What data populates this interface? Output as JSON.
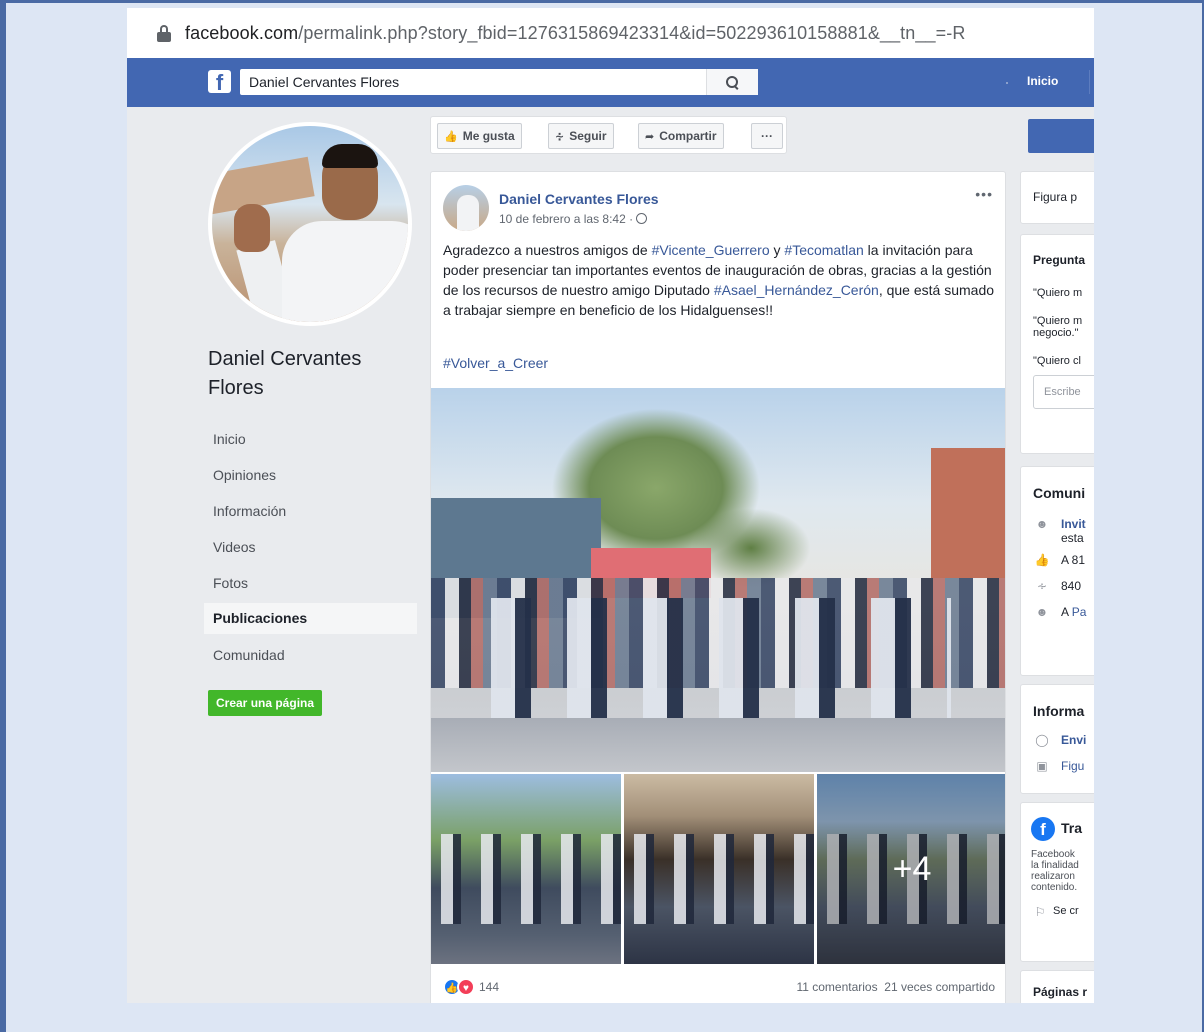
{
  "browser": {
    "url_host": "facebook.com",
    "url_rest": "/permalink.php?story_fbid=1276315869423314&id=502293610158881&__tn__=-R"
  },
  "topbar": {
    "logo": "f",
    "search_value": "Daniel Cervantes Flores",
    "home_label": "Inicio"
  },
  "page": {
    "name": "Daniel Cervantes Flores",
    "nav": [
      {
        "label": "Inicio"
      },
      {
        "label": "Opiniones"
      },
      {
        "label": "Información"
      },
      {
        "label": "Videos"
      },
      {
        "label": "Fotos"
      },
      {
        "label": "Publicaciones",
        "active": true
      },
      {
        "label": "Comunidad"
      }
    ],
    "create_page_label": "Crear una página"
  },
  "actions": {
    "like_label": "Me gusta",
    "follow_label": "Seguir",
    "share_label": "Compartir",
    "more_label": "···"
  },
  "post": {
    "author": "Daniel Cervantes Flores",
    "date": "10 de febrero a las 8:42 ·",
    "more": "•••",
    "text_1": "Agradezco a nuestros amigos de ",
    "tag_1": "#Vicente_Guerrero",
    "text_2": " y ",
    "tag_2": "#Tecomatlan",
    "text_3": " la invitación para poder presenciar tan importantes eventos de inauguración de obras, gracias a la gestión de los recursos de nuestro amigo Diputado ",
    "tag_3": "#Asael_Hernández_Cerón",
    "text_4": ", que está sumado a trabajar siempre en beneficio de los Hidalguenses!!",
    "hashtag": "#Volver_a_Creer",
    "more_photos": "+4",
    "reactions_count": "144",
    "comments": "11 comentarios",
    "shares": "21 veces compartido"
  },
  "sidebar": {
    "card1_title": "Figura p",
    "card2_title": "Pregunta",
    "q1": "\"Quiero m",
    "q2a": "\"Quiero m",
    "q2b": "negocio.\"",
    "q3": "\"Quiero cl",
    "input_placeholder": "Escribe",
    "card3_title": "Comuni",
    "c1a": "Invit",
    "c1b": "esta",
    "c2": "A 81",
    "c3": "840",
    "c4_prefix": "A ",
    "c4_link": "Pa",
    "card4_title": "Informa",
    "i1": "Envi",
    "i2": "Figu",
    "card5_title": "Tra",
    "t1": "Facebook",
    "t2": "la finalidad",
    "t3": "realizaron",
    "t4": "contenido.",
    "t5": "Se cr",
    "card6_title": "Páginas r"
  },
  "colors": {
    "fb_blue": "#4267b2",
    "link": "#385898",
    "create_green": "#42b72a"
  }
}
